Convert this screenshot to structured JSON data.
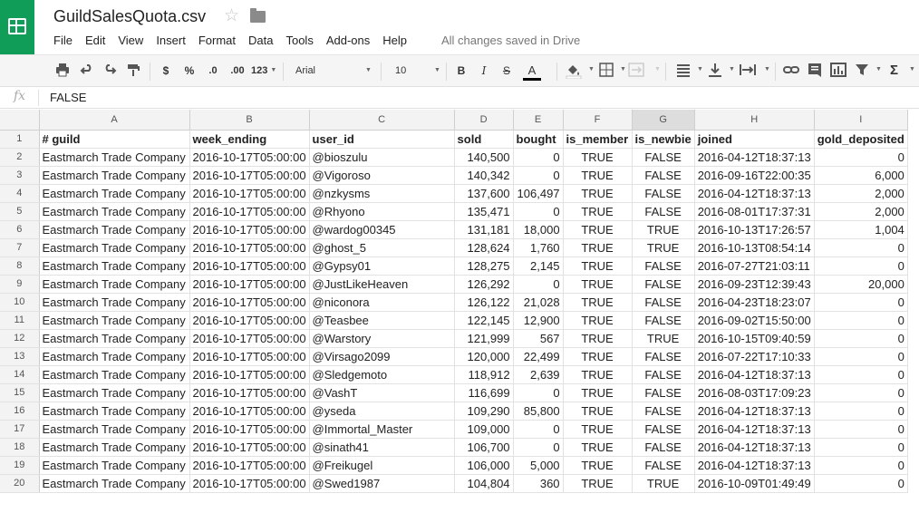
{
  "app": {
    "title": "GuildSalesQuota.csv",
    "save_status": "All changes saved in Drive",
    "menu": [
      "File",
      "Edit",
      "View",
      "Insert",
      "Format",
      "Data",
      "Tools",
      "Add-ons",
      "Help"
    ]
  },
  "toolbar": {
    "currency": "$",
    "percent": "%",
    "decrease_decimals": ".0",
    "increase_decimals": ".00",
    "more_formats": "123",
    "font": "Arial",
    "font_size": "10",
    "bold": "B",
    "italic": "I",
    "strike": "S",
    "text_color": "A",
    "text_color_swatch": "#000000"
  },
  "formula_bar": {
    "fx": "fx",
    "value": "FALSE"
  },
  "sheet": {
    "column_letters": [
      "A",
      "B",
      "C",
      "D",
      "E",
      "F",
      "G",
      "H",
      "I"
    ],
    "selected_column": "G",
    "header": [
      "# guild",
      "week_ending",
      "user_id",
      "sold",
      "bought",
      "is_member",
      "is_newbie",
      "joined",
      "gold_deposited"
    ],
    "rows": [
      [
        "Eastmarch Trade Company",
        "2016-10-17T05:00:00",
        "@bioszulu",
        "140,500",
        "0",
        "TRUE",
        "FALSE",
        "2016-04-12T18:37:13",
        "0"
      ],
      [
        "Eastmarch Trade Company",
        "2016-10-17T05:00:00",
        "@Vigoroso",
        "140,342",
        "0",
        "TRUE",
        "FALSE",
        "2016-09-16T22:00:35",
        "6,000"
      ],
      [
        "Eastmarch Trade Company",
        "2016-10-17T05:00:00",
        "@nzkysms",
        "137,600",
        "106,497",
        "TRUE",
        "FALSE",
        "2016-04-12T18:37:13",
        "2,000"
      ],
      [
        "Eastmarch Trade Company",
        "2016-10-17T05:00:00",
        "@Rhyono",
        "135,471",
        "0",
        "TRUE",
        "FALSE",
        "2016-08-01T17:37:31",
        "2,000"
      ],
      [
        "Eastmarch Trade Company",
        "2016-10-17T05:00:00",
        "@wardog00345",
        "131,181",
        "18,000",
        "TRUE",
        "TRUE",
        "2016-10-13T17:26:57",
        "1,004"
      ],
      [
        "Eastmarch Trade Company",
        "2016-10-17T05:00:00",
        "@ghost_5",
        "128,624",
        "1,760",
        "TRUE",
        "TRUE",
        "2016-10-13T08:54:14",
        "0"
      ],
      [
        "Eastmarch Trade Company",
        "2016-10-17T05:00:00",
        "@Gypsy01",
        "128,275",
        "2,145",
        "TRUE",
        "FALSE",
        "2016-07-27T21:03:11",
        "0"
      ],
      [
        "Eastmarch Trade Company",
        "2016-10-17T05:00:00",
        "@JustLikeHeaven",
        "126,292",
        "0",
        "TRUE",
        "FALSE",
        "2016-09-23T12:39:43",
        "20,000"
      ],
      [
        "Eastmarch Trade Company",
        "2016-10-17T05:00:00",
        "@niconora",
        "126,122",
        "21,028",
        "TRUE",
        "FALSE",
        "2016-04-23T18:23:07",
        "0"
      ],
      [
        "Eastmarch Trade Company",
        "2016-10-17T05:00:00",
        "@Teasbee",
        "122,145",
        "12,900",
        "TRUE",
        "FALSE",
        "2016-09-02T15:50:00",
        "0"
      ],
      [
        "Eastmarch Trade Company",
        "2016-10-17T05:00:00",
        "@Warstory",
        "121,999",
        "567",
        "TRUE",
        "TRUE",
        "2016-10-15T09:40:59",
        "0"
      ],
      [
        "Eastmarch Trade Company",
        "2016-10-17T05:00:00",
        "@Virsago2099",
        "120,000",
        "22,499",
        "TRUE",
        "FALSE",
        "2016-07-22T17:10:33",
        "0"
      ],
      [
        "Eastmarch Trade Company",
        "2016-10-17T05:00:00",
        "@Sledgemoto",
        "118,912",
        "2,639",
        "TRUE",
        "FALSE",
        "2016-04-12T18:37:13",
        "0"
      ],
      [
        "Eastmarch Trade Company",
        "2016-10-17T05:00:00",
        "@VashT",
        "116,699",
        "0",
        "TRUE",
        "FALSE",
        "2016-08-03T17:09:23",
        "0"
      ],
      [
        "Eastmarch Trade Company",
        "2016-10-17T05:00:00",
        "@yseda",
        "109,290",
        "85,800",
        "TRUE",
        "FALSE",
        "2016-04-12T18:37:13",
        "0"
      ],
      [
        "Eastmarch Trade Company",
        "2016-10-17T05:00:00",
        "@Immortal_Master",
        "109,000",
        "0",
        "TRUE",
        "FALSE",
        "2016-04-12T18:37:13",
        "0"
      ],
      [
        "Eastmarch Trade Company",
        "2016-10-17T05:00:00",
        "@sinath41",
        "106,700",
        "0",
        "TRUE",
        "FALSE",
        "2016-04-12T18:37:13",
        "0"
      ],
      [
        "Eastmarch Trade Company",
        "2016-10-17T05:00:00",
        "@Freikugel",
        "106,000",
        "5,000",
        "TRUE",
        "FALSE",
        "2016-04-12T18:37:13",
        "0"
      ],
      [
        "Eastmarch Trade Company",
        "2016-10-17T05:00:00",
        "@Swed1987",
        "104,804",
        "360",
        "TRUE",
        "TRUE",
        "2016-10-09T01:49:49",
        "0"
      ]
    ]
  }
}
